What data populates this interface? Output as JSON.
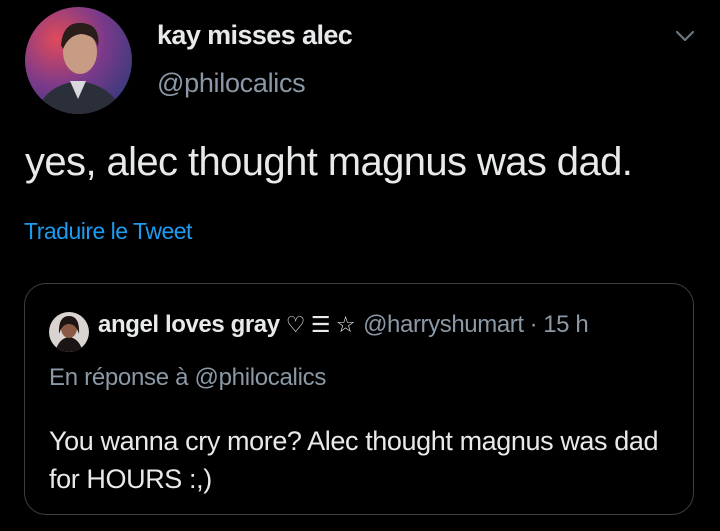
{
  "tweet": {
    "display_name": "kay misses alec",
    "handle": "@philocalics",
    "text": "yes, alec thought magnus was dad.",
    "translate_label": "Traduire le Tweet",
    "menu_icon": "chevron-down-icon"
  },
  "quoted_tweet": {
    "display_name": "angel loves gray",
    "name_emoji": "♡ ☰ ☆",
    "handle": "@harryshumart",
    "separator": "·",
    "time": "15 h",
    "reply_context": "En réponse à @philocalics",
    "text": "You wanna cry more? Alec thought magnus was dad for HOURS :,)"
  },
  "colors": {
    "background": "#000000",
    "text_primary": "#e7e9ea",
    "text_secondary": "#8b98a5",
    "link": "#1d9bf0",
    "border": "#3a3f44"
  }
}
